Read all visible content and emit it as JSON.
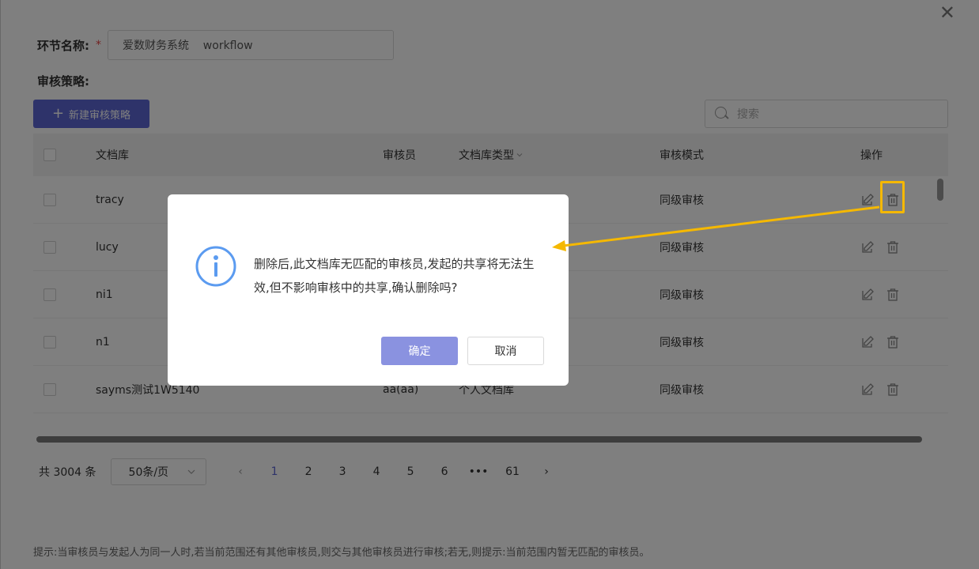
{
  "form": {
    "name_label": "环节名称:",
    "required_mark": "*",
    "name_value": "爱数财务系统    workflow",
    "policy_label": "审核策略:"
  },
  "toolbar": {
    "new_button_label": "新建审核策略",
    "search_placeholder": "搜索"
  },
  "table": {
    "headers": {
      "library": "文档库",
      "auditor": "审核员",
      "library_type": "文档库类型",
      "audit_mode": "审核模式",
      "actions": "操作"
    },
    "rows": [
      {
        "library": "tracy",
        "auditor": "",
        "library_type": "",
        "audit_mode": "同级审核"
      },
      {
        "library": "lucy",
        "auditor": "",
        "library_type": "",
        "audit_mode": "同级审核"
      },
      {
        "library": "ni1",
        "auditor": "",
        "library_type": "",
        "audit_mode": "同级审核"
      },
      {
        "library": "n1",
        "auditor": "",
        "library_type": "",
        "audit_mode": "同级审核"
      },
      {
        "library": "sayms测试1W5140",
        "auditor": "aa(aa)",
        "library_type": "个人文档库",
        "audit_mode": "同级审核"
      }
    ]
  },
  "pagination": {
    "total": "共 3004 条",
    "page_size": "50条/页",
    "pages": [
      "1",
      "2",
      "3",
      "4",
      "5",
      "6",
      "•••",
      "61"
    ],
    "current_page": "1"
  },
  "hint": "提示:当审核员与发起人为同一人时,若当前范围还有其他审核员,则交与其他审核员进行审核;若无,则提示:当前范围内暂无匹配的审核员。",
  "dialog": {
    "message": "删除后,此文档库无匹配的审核员,发起的共享将无法生效,但不影响审核中的共享,确认删除吗?",
    "confirm_label": "确定",
    "cancel_label": "取消"
  },
  "colors": {
    "primary": "#5d66d4",
    "dialog_confirm": "#8a92e0",
    "info_icon": "#5b9bf0",
    "annotation": "#f5b800",
    "overlay": "rgba(0,0,0,0.5)"
  },
  "icons": [
    "close-icon",
    "plus-icon",
    "search-icon",
    "sort-chevron-icon",
    "edit-icon",
    "trash-icon",
    "chevron-down-icon",
    "chevron-left-icon",
    "chevron-right-icon",
    "info-circle-icon"
  ]
}
